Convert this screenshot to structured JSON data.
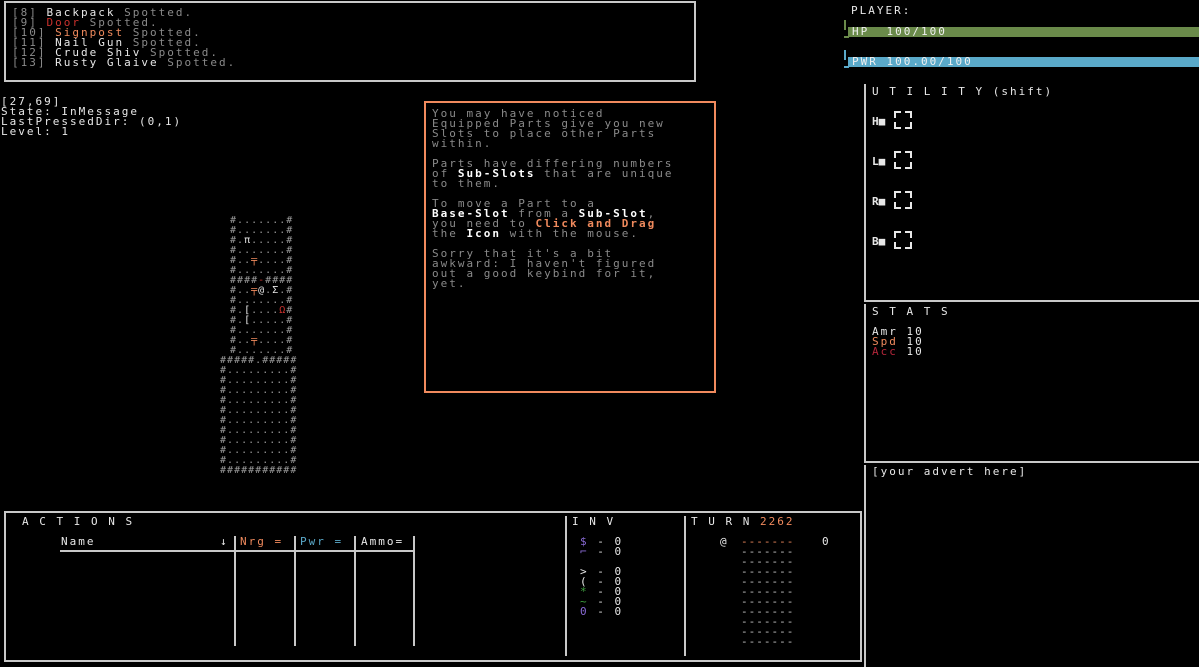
{
  "colors": {
    "hp_bar": "#6a8a4a",
    "pwr_bar": "#5aa9c9",
    "panel_border": "#c8c8c8",
    "tutorial_border": "#f08a5d",
    "accent_orange": "#f08a5d",
    "red": "#c9302c",
    "inv_green": "#3fa33f",
    "inv_purple": "#8a6bd6",
    "nrg": "#f08a5d",
    "pwr": "#5aa9c9"
  },
  "log": [
    {
      "id": "[8]",
      "name": "Backpack",
      "name_color": "white",
      "suffix": "Spotted."
    },
    {
      "id": "[9]",
      "name": "Door",
      "name_color": "red",
      "suffix": "Spotted."
    },
    {
      "id": "[10]",
      "name": "Signpost",
      "name_color": "orange",
      "suffix": "Spotted."
    },
    {
      "id": "[11]",
      "name": "Nail Gun",
      "name_color": "white",
      "suffix": "Spotted."
    },
    {
      "id": "[12]",
      "name": "Crude Shiv",
      "name_color": "white",
      "suffix": "Spotted."
    },
    {
      "id": "[13]",
      "name": "Rusty Glaive",
      "name_color": "white",
      "suffix": "Spotted."
    }
  ],
  "debug": {
    "coords": "[27,69]",
    "state": "State: InMessage",
    "last_dir": "LastPressedDir: (0,1)",
    "level": "Level: 1"
  },
  "tutorial": {
    "p1": "You may have noticed\nEquipped Parts give you new\nSlots to place other Parts\nwithin.",
    "p2_a": "Parts have differing numbers\nof ",
    "p2_hl": "Sub-Slots",
    "p2_b": " that are unique\nto them.",
    "p3_l1a": "To move a Part to a",
    "p3_l2a": "Base-Slot",
    "p3_l2b": " from a ",
    "p3_l2c": "Sub-Slot",
    "p3_l2d": ",",
    "p3_l3a": "you need to ",
    "p3_l3b": "Click and Drag",
    "p3_l4a": "the ",
    "p3_l4b": "Icon",
    "p3_l4c": " with the mouse.",
    "p4": "Sorry that it's a bit\nawkward: I haven't figured\nout a good keybind for it,\nyet."
  },
  "player": {
    "title": "PLAYER:",
    "hp_label": "HP  100/100",
    "hp": {
      "value": 100,
      "max": 100
    },
    "pwr_label": "PWR 100.00/100",
    "pwr": {
      "value": 100,
      "max": 100
    }
  },
  "utility": {
    "title": "U T I L I T Y (shift)",
    "slots": [
      "H",
      "L",
      "R",
      "B"
    ]
  },
  "stats": {
    "title": "S T A T S",
    "rows": [
      {
        "label": "Amr",
        "value": "10",
        "color": "#e8e8e8"
      },
      {
        "label": "Spd",
        "value": "10",
        "color": "#f08a5d"
      },
      {
        "label": "Acc",
        "value": "10",
        "color": "#b3263a"
      }
    ]
  },
  "advert": "[your advert here]",
  "actions": {
    "title": "A C T I O N S",
    "col_name": "Name",
    "sort_icon": "↓",
    "col_nrg": "Nrg =",
    "col_pwr": "Pwr =",
    "col_ammo": "Ammo="
  },
  "inv": {
    "title": "I N V",
    "rows": [
      {
        "icon": "$",
        "color": "#8a6bd6",
        "dash": "-",
        "count": "0"
      },
      {
        "icon": "⌐",
        "color": "#8a6bd6",
        "dash": "-",
        "count": "0"
      },
      {
        "icon": "",
        "color": "#000",
        "dash": "",
        "count": ""
      },
      {
        "icon": ">",
        "color": "#e8e8e8",
        "dash": "-",
        "count": "0"
      },
      {
        "icon": "(",
        "color": "#e8e8e8",
        "dash": "-",
        "count": "0"
      },
      {
        "icon": "*",
        "color": "#3fa33f",
        "dash": "-",
        "count": "0"
      },
      {
        "icon": "~",
        "color": "#3fa33f",
        "dash": "-",
        "count": "0"
      },
      {
        "icon": "0",
        "color": "#8a6bd6",
        "dash": "-",
        "count": "0"
      }
    ]
  },
  "turn": {
    "title": "T U R N",
    "number": "2262",
    "player_icon": "@",
    "first_count": "0",
    "dashes": "-------"
  },
  "map": [
    "#.......#",
    "#.......#",
    "#.π.....#",
    "#.......#",
    "#..╤....#",
    "#.......#",
    "####-####",
    "#..╤@.Σ.#",
    "#.......#",
    "#.[....Ω#",
    "#.[.....#",
    "#.......#",
    "#..╤....#",
    "#.......#",
    "#####.#####",
    "#.........#",
    "#.........#",
    "#.........#",
    "#.........#",
    "#.........#",
    "#.........#",
    "#.........#",
    "#.........#",
    "#.........#",
    "#.........#",
    "###########"
  ]
}
